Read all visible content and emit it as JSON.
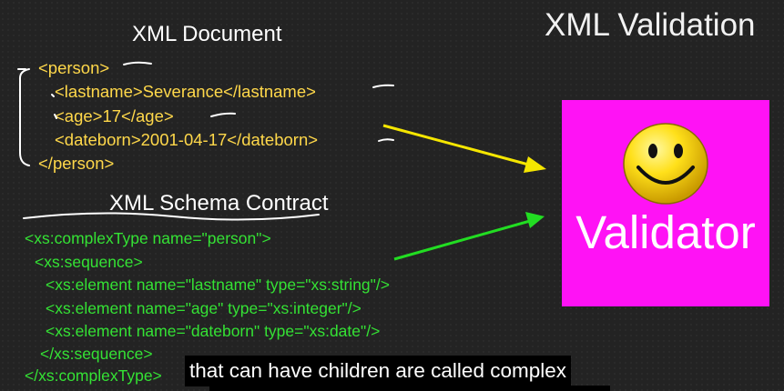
{
  "slide": {
    "title": "XML Validation",
    "xml_document": {
      "heading": "XML Document",
      "lines": [
        "<person>",
        "<lastname>Severance</lastname>",
        "<age>17</age>",
        "<dateborn>2001-04-17</dateborn>",
        "</person>"
      ]
    },
    "schema": {
      "heading": "XML Schema Contract",
      "lines": [
        "<xs:complexType name=\"person\">",
        "<xs:sequence>",
        "<xs:element name=\"lastname\" type=\"xs:string\"/>",
        "<xs:element name=\"age\" type=\"xs:integer\"/>",
        "<xs:element name=\"dateborn\" type=\"xs:date\"/>",
        "</xs:sequence>",
        "</xs:complexType>"
      ]
    },
    "validator": {
      "label": "Validator",
      "icon": "smiley-face-icon",
      "box_color": "#ff12f5"
    },
    "colors": {
      "background": "#232323",
      "xml_text": "#ffd84a",
      "schema_text": "#34e234",
      "yellow_arrow": "#f5e600",
      "green_arrow": "#22dd22"
    }
  },
  "video": {
    "caption": "that can have children are called complex"
  }
}
